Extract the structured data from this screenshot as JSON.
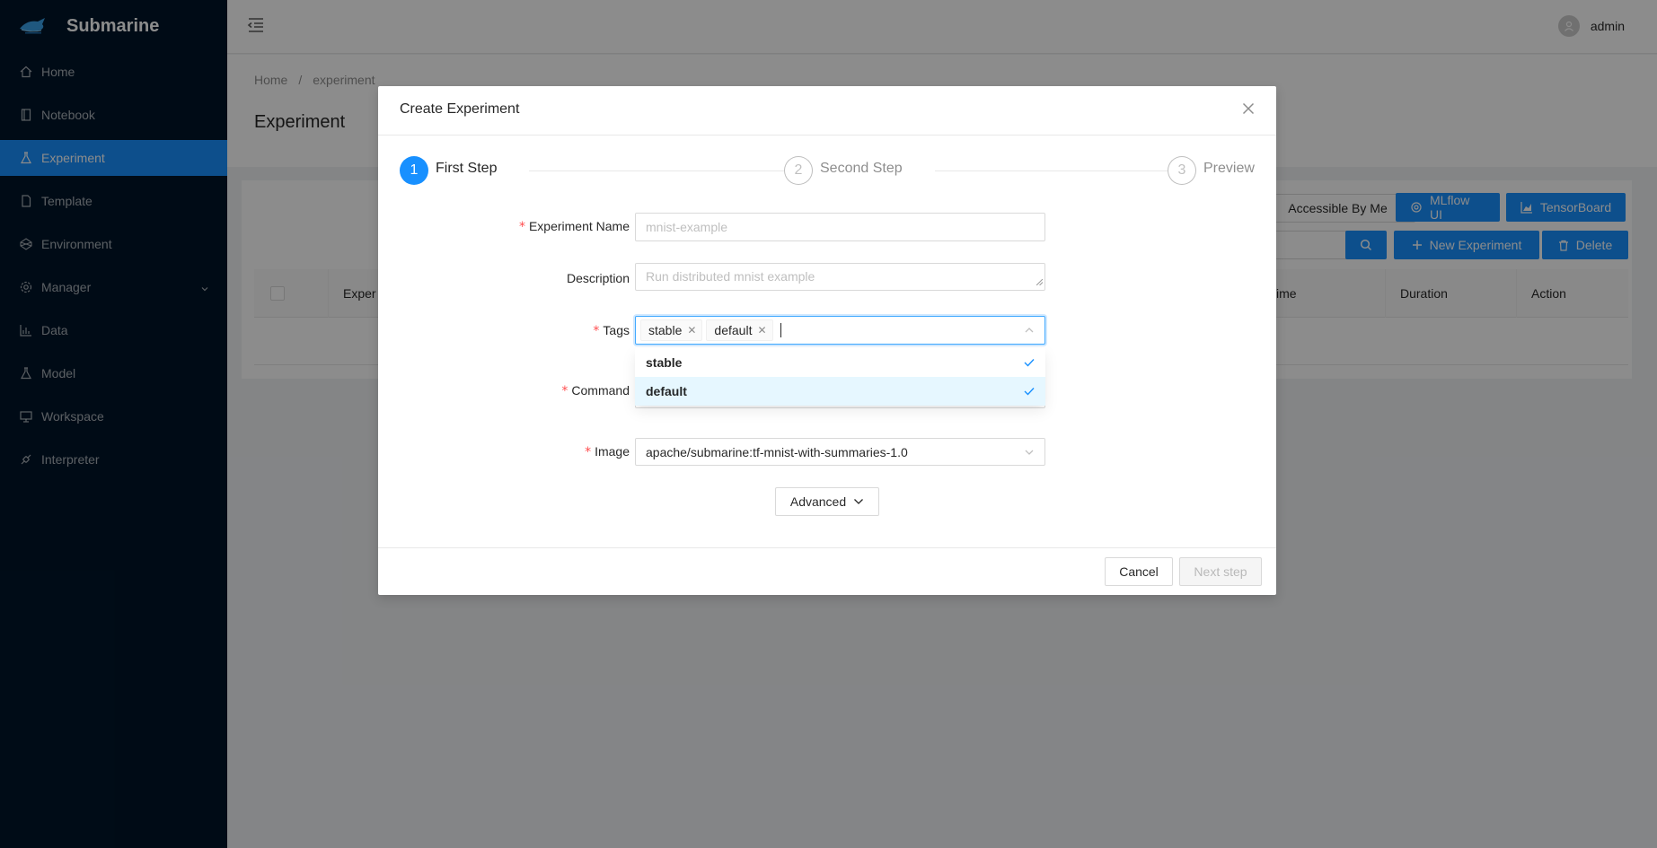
{
  "app": {
    "name": "Submarine"
  },
  "sidebar": {
    "items": [
      {
        "label": "Home",
        "icon": "home-icon"
      },
      {
        "label": "Notebook",
        "icon": "book-icon"
      },
      {
        "label": "Experiment",
        "icon": "experiment-icon",
        "active": true
      },
      {
        "label": "Template",
        "icon": "file-icon"
      },
      {
        "label": "Environment",
        "icon": "codepen-icon"
      },
      {
        "label": "Manager",
        "icon": "setting-icon",
        "expandable": true
      },
      {
        "label": "Data",
        "icon": "bar-chart-icon"
      },
      {
        "label": "Model",
        "icon": "experiment-icon"
      },
      {
        "label": "Workspace",
        "icon": "desktop-icon"
      },
      {
        "label": "Interpreter",
        "icon": "api-icon"
      }
    ]
  },
  "header": {
    "user": "admin"
  },
  "breadcrumb": {
    "home": "Home",
    "separator": "/",
    "current": "experiment"
  },
  "page": {
    "title": "Experiment"
  },
  "toolbar": {
    "filter_label": "Accessible By Me",
    "mlflow_label": "MLflow UI",
    "tensorboard_label": "TensorBoard",
    "new_label": "New Experiment",
    "delete_label": "Delete"
  },
  "table": {
    "columns": [
      "Exper",
      "Time",
      "Duration",
      "Action"
    ]
  },
  "modal": {
    "title": "Create Experiment",
    "steps": [
      {
        "number": "1",
        "title": "First Step",
        "status": "process"
      },
      {
        "number": "2",
        "title": "Second Step",
        "status": "wait"
      },
      {
        "number": "3",
        "title": "Preview",
        "status": "wait"
      }
    ],
    "form": {
      "name_label": "Experiment Name",
      "name_placeholder": "mnist-example",
      "description_label": "Description",
      "description_placeholder": "Run distributed mnist example",
      "tags_label": "Tags",
      "tags": [
        "stable",
        "default"
      ],
      "tag_options": [
        {
          "label": "stable",
          "selected": true
        },
        {
          "label": "default",
          "selected": true
        }
      ],
      "command_label": "Command",
      "image_label": "Image",
      "image_value": "apache/submarine:tf-mnist-with-summaries-1.0",
      "required_mark": "*"
    },
    "advanced_label": "Advanced",
    "cancel_label": "Cancel",
    "next_label": "Next step"
  },
  "colors": {
    "primary": "#1890ff",
    "sidebar_bg": "#001529",
    "required": "#ff4d4f"
  }
}
